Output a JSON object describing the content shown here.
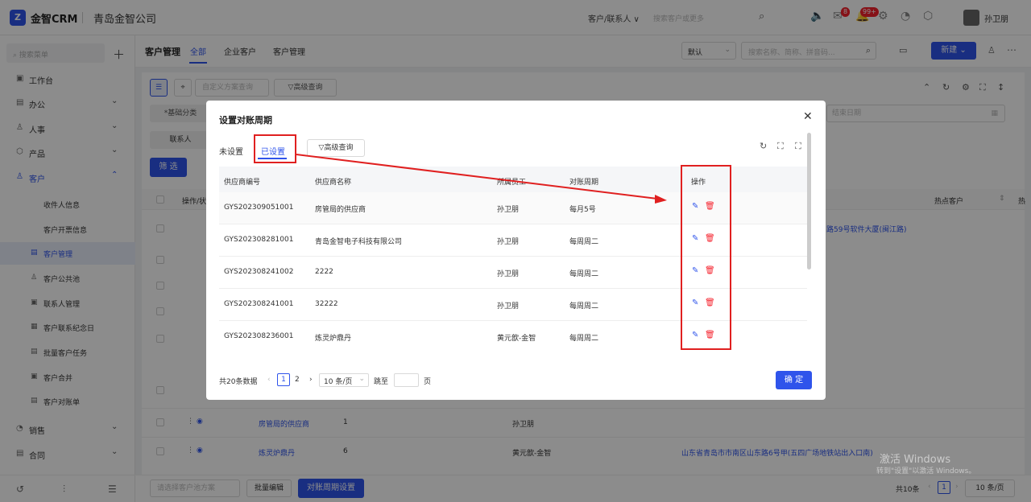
{
  "app": {
    "logo_mark": "Z",
    "name": "金智CRM",
    "company": "青岛金智公司"
  },
  "topbar": {
    "search_scope": "客户/联系人 ∨",
    "search_placeholder": "搜索客户或更多",
    "notif_badge": "8",
    "bell_badge": "99+",
    "username": "孙卫朋"
  },
  "sidebar": {
    "search_placeholder": "搜索菜单",
    "items": [
      {
        "label": "工作台",
        "icon": "dashboard-icon"
      },
      {
        "label": "办公",
        "icon": "office-icon"
      },
      {
        "label": "人事",
        "icon": "people-icon"
      },
      {
        "label": "产品",
        "icon": "product-icon"
      },
      {
        "label": "客户",
        "icon": "customer-icon"
      }
    ],
    "subitems": [
      {
        "label": "收件人信息"
      },
      {
        "label": "客户开票信息"
      },
      {
        "label": "客户管理"
      },
      {
        "label": "客户公共池"
      },
      {
        "label": "联系人管理"
      },
      {
        "label": "客户联系纪念日"
      },
      {
        "label": "批量客户任务"
      },
      {
        "label": "客户合并"
      },
      {
        "label": "客户对账单"
      }
    ],
    "bottom_items": [
      {
        "label": "销售"
      },
      {
        "label": "合同"
      }
    ]
  },
  "main": {
    "title": "客户管理",
    "tabs": [
      "全部",
      "企业客户",
      "客户管理"
    ],
    "sort_value": "默认",
    "search_placeholder": "搜索名称、简称、拼音码...",
    "new_label": "新建",
    "custom_query_placeholder": "自定义方案查询",
    "adv_query": "高级查询",
    "basic_category": "*基础分类",
    "contact_label": "联系人",
    "filter_label": "筛 选",
    "end_date_placeholder": "结束日期",
    "col_ops": "操作/状",
    "col_hot": "热点客户",
    "col_more": "热",
    "bg_address_1": "路59号软件大厦(闽江路)",
    "bg_rows": [
      {
        "name": "房管局的供应商",
        "count": "1",
        "owner": "孙卫朋",
        "address": ""
      },
      {
        "name": "炼灵炉鼎丹",
        "count": "6",
        "owner": "黄元歆-金智",
        "address": "山东省青岛市市南区山东路6号甲(五四广场地铁站出入口南)"
      }
    ],
    "bottom": {
      "scheme_placeholder": "请选择客户池方案",
      "batch_edit": "批量编辑",
      "period_setting": "对账周期设置",
      "total": "共10条",
      "page": "1",
      "page_size": "10 条/页"
    }
  },
  "modal": {
    "title": "设置对账周期",
    "tabs": {
      "unset": "未设置",
      "set": "已设置"
    },
    "adv_query": "高级查询",
    "columns": [
      "供应商编号",
      "供应商名称",
      "所属员工",
      "对账周期",
      "操作"
    ],
    "rows": [
      {
        "code": "GYS202309051001",
        "name": "房管局的供应商",
        "staff": "孙卫朋",
        "period": "每月5号"
      },
      {
        "code": "GYS202308281001",
        "name": "青岛金智电子科技有限公司",
        "staff": "孙卫朋",
        "period": "每周周二"
      },
      {
        "code": "GYS202308241002",
        "name": "2222",
        "staff": "孙卫朋",
        "period": "每周周二"
      },
      {
        "code": "GYS202308241001",
        "name": "32222",
        "staff": "孙卫朋",
        "period": "每周周二"
      },
      {
        "code": "GYS202308236001",
        "name": "炼灵炉鼎丹",
        "staff": "黄元歆-金智",
        "period": "每周周二"
      }
    ],
    "pagination": {
      "total": "共20条数据",
      "pages": [
        "1",
        "2"
      ],
      "current": "1",
      "page_size": "10 条/页",
      "jump_label": "跳至",
      "page_unit": "页"
    },
    "ok": "确 定"
  },
  "watermark": {
    "line1": "激活 Windows",
    "line2": "转到\"设置\"以激活 Windows。"
  },
  "colors": {
    "accent": "#2f54eb",
    "danger": "#f5222d",
    "annotation": "#e02020"
  }
}
